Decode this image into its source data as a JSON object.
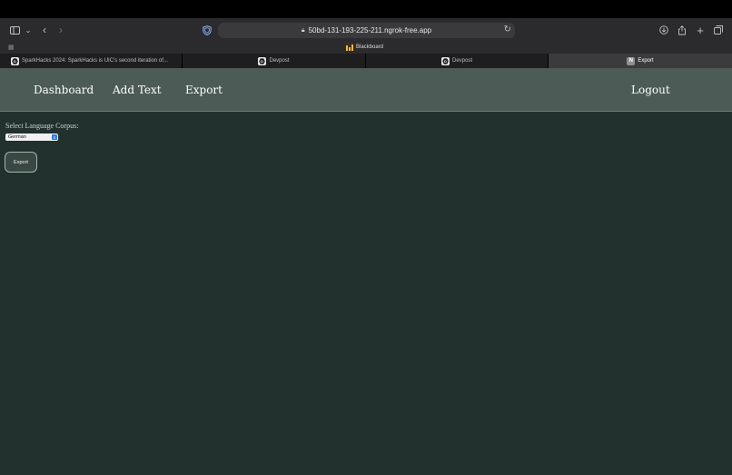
{
  "browser": {
    "url": "50bd-131-193-225-211.ngrok-free.app",
    "favorites": [
      {
        "label": "Blackboard"
      }
    ],
    "tabs": [
      {
        "label": "SparkHacks 2024: SparkHacks is UIC's second iteration of...",
        "icon": "devpost-icon"
      },
      {
        "label": "Devpost",
        "icon": "devpost-icon"
      },
      {
        "label": "Devpost",
        "icon": "devpost-icon"
      },
      {
        "label": "Export",
        "icon": "n-icon",
        "icon_letter": "N",
        "active": true
      }
    ]
  },
  "nav": {
    "dashboard": "Dashboard",
    "add_text": "Add Text",
    "export": "Export",
    "logout": "Logout"
  },
  "form": {
    "select_label": "Select Language Corpus:",
    "selected_language": "German",
    "export_button": "Export"
  },
  "colors": {
    "nav_bg": "#4c5b55",
    "page_bg": "#22312d",
    "button_bg": "#3a4844"
  }
}
